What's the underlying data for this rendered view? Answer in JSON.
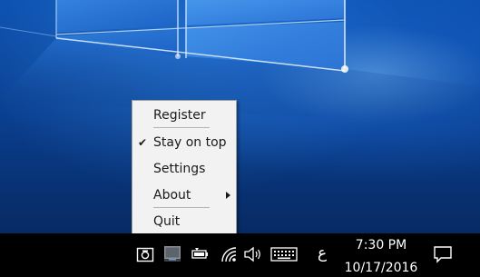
{
  "menu": {
    "items": [
      {
        "label": "Register"
      },
      {
        "label": "Stay on top"
      },
      {
        "label": "Settings"
      },
      {
        "label": "About"
      },
      {
        "label": "Quit"
      }
    ],
    "stay_on_top_checked": true
  },
  "taskbar": {
    "ime_indicator": "ع",
    "clock": {
      "time": "7:30 PM",
      "date": "10/17/2016"
    },
    "tray_icons": [
      "app-camera-icon",
      "screen-app-icon",
      "battery-icon",
      "wifi-icon",
      "volume-icon",
      "touch-keyboard-icon",
      "action-center-icon"
    ]
  },
  "colors": {
    "taskbar": "#000000",
    "menu_background": "#f2f2f2",
    "desktop_blue": "#0a4fae"
  }
}
